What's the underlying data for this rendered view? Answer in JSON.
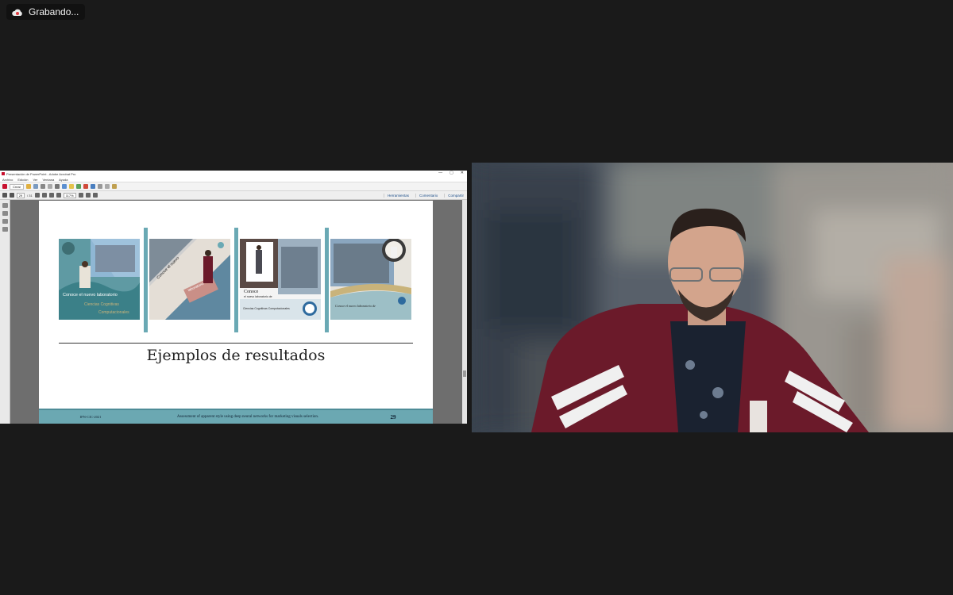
{
  "recording": {
    "label": "Grabando..."
  },
  "window": {
    "title": "Presentación de PowerPoint - Adobe Acrobat Pro",
    "controls": [
      "—",
      "▢",
      "✕"
    ],
    "menu": [
      "Archivo",
      "Edición",
      "Ver",
      "Ventana",
      "Ayuda"
    ],
    "create_label": "Crear",
    "page_current": "29",
    "page_total": "/ 31",
    "zoom": "117%",
    "right_tools": [
      "Herramientas",
      "Comentario",
      "Compartir"
    ]
  },
  "slide": {
    "title": "Ejemplos de resultados",
    "cards": [
      {
        "line1": "Conoce el nuevo laboratorio",
        "line2": "Ciencias Cognitivas",
        "line3": "Computacionales"
      },
      {
        "line1": "Conoce el nuevo",
        "line2": "laboratorio"
      },
      {
        "line1": "Conoce",
        "line2": "el nuevo laboratorio de",
        "line3": "Ciencias Cognitivas Computacionales"
      },
      {
        "line1": "Conoce el nuevo laboratorio de"
      }
    ],
    "footer_left": "IPN-CIC-2021",
    "footer_mid": "Assessment of apparent style using deep neural networks for marketing visuals selection.",
    "page_number": "29"
  },
  "colors": {
    "accent_teal": "#6aa9b4",
    "background": "#1a1a1a",
    "jacket": "#6b1a2a"
  }
}
